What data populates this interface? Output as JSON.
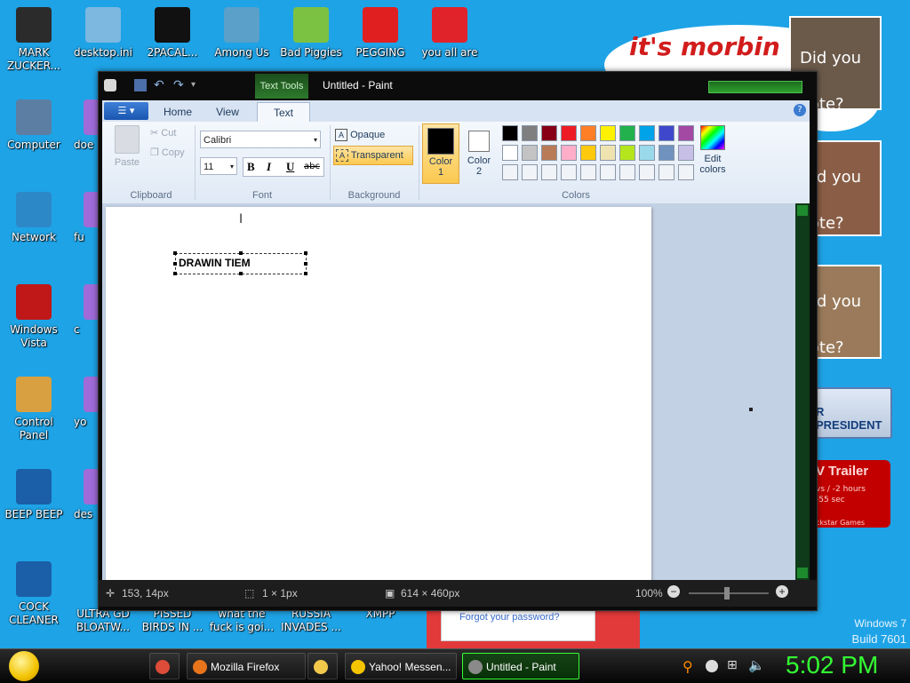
{
  "desktop": {
    "icons_left": [
      {
        "label": "MARK ZUCKER...",
        "color": "#2b2b2b"
      },
      {
        "label": "Computer",
        "color": "#5c7ea3"
      },
      {
        "label": "Network",
        "color": "#2d88c8"
      },
      {
        "label": "Windows Vista",
        "color": "#c01818"
      },
      {
        "label": "Control Panel",
        "color": "#d8a040"
      },
      {
        "label": "BEEP BEEP",
        "color": "#1b5fa8"
      },
      {
        "label": "COCK CLEANER",
        "color": "#1b5fa8"
      }
    ],
    "icons_top": [
      {
        "label": "desktop.ini",
        "color": "#7cb8e0"
      },
      {
        "label": "2PACAL...",
        "color": "#111111"
      },
      {
        "label": "Among Us",
        "color": "#5aa0c8"
      },
      {
        "label": "Bad Piggies",
        "color": "#7cc242"
      },
      {
        "label": "PEGGING",
        "color": "#e02020"
      },
      {
        "label": "you all are",
        "color": "#e0232b"
      }
    ],
    "icons_col2_partial": [
      "doe",
      "fu",
      "c",
      "yo",
      "des"
    ],
    "icons_bottom": [
      "ULTRA GD BLOATW...",
      "PISSED BIRDS IN ...",
      "what the fuck is goi...",
      "RUSSIA INVADES ...",
      "XMPP"
    ],
    "banner_text": "it's morbin t",
    "poster_texts": [
      "Did you Vote?",
      "Did you Vote?",
      "Did you Vote?"
    ],
    "president_label": "R PRESIDENT",
    "trailer_title": "V Trailer",
    "trailer_sub": "vs / -2 hours",
    "trailer_sub2": "-55 sec",
    "trailer_brand": "ckstar Games",
    "forgot_link": "Forgot your password?",
    "watermark_line1": "Windows 7",
    "watermark_line2": "Build 7601"
  },
  "paint": {
    "title": "Untitled - Paint",
    "context_tab": "Text Tools",
    "tabs": [
      "Home",
      "View",
      "Text"
    ],
    "active_tab": "Text",
    "clipboard": {
      "paste": "Paste",
      "cut": "Cut",
      "copy": "Copy",
      "group": "Clipboard"
    },
    "font": {
      "family": "Calibri",
      "size": "11",
      "bold": "B",
      "italic": "I",
      "underline": "U",
      "strike": "abc",
      "group": "Font"
    },
    "background": {
      "opaque": "Opaque",
      "transparent": "Transparent",
      "group": "Background"
    },
    "colors": {
      "color1_label": "Color",
      "color1_num": "1",
      "color2_label": "Color",
      "color2_num": "2",
      "edit_label": "Edit",
      "edit_label2": "colors",
      "group": "Colors",
      "color1": "#000000",
      "color2": "#ffffff",
      "row1": [
        "#000000",
        "#7f7f7f",
        "#880015",
        "#ed1c24",
        "#ff7f27",
        "#fff200",
        "#22b14c",
        "#00a2e8",
        "#3f48cc",
        "#a349a4"
      ],
      "row2": [
        "#ffffff",
        "#c3c3c3",
        "#b97a57",
        "#ffaec9",
        "#ffc90e",
        "#efe4b0",
        "#b5e61d",
        "#99d9ea",
        "#7092be",
        "#c8bfe7"
      ]
    },
    "textbox_value": "DRAWIN TIEM",
    "status": {
      "cursor": "153, 14px",
      "selection": "1 × 1px",
      "canvas_size": "614 × 460px",
      "zoom": "100%"
    }
  },
  "taskbar": {
    "buttons": [
      {
        "label": "",
        "icon_color": "#dd4b39"
      },
      {
        "label": "Mozilla Firefox",
        "icon_color": "#e8741c"
      },
      {
        "label": "",
        "icon_color": "#f2c84b"
      },
      {
        "label": "Yahoo! Messen...",
        "icon_color": "#f5c400"
      },
      {
        "label": "Untitled - Paint",
        "icon_color": "#8a8a8a"
      }
    ],
    "clock": "5:02 PM",
    "accent": "#33ff33"
  }
}
